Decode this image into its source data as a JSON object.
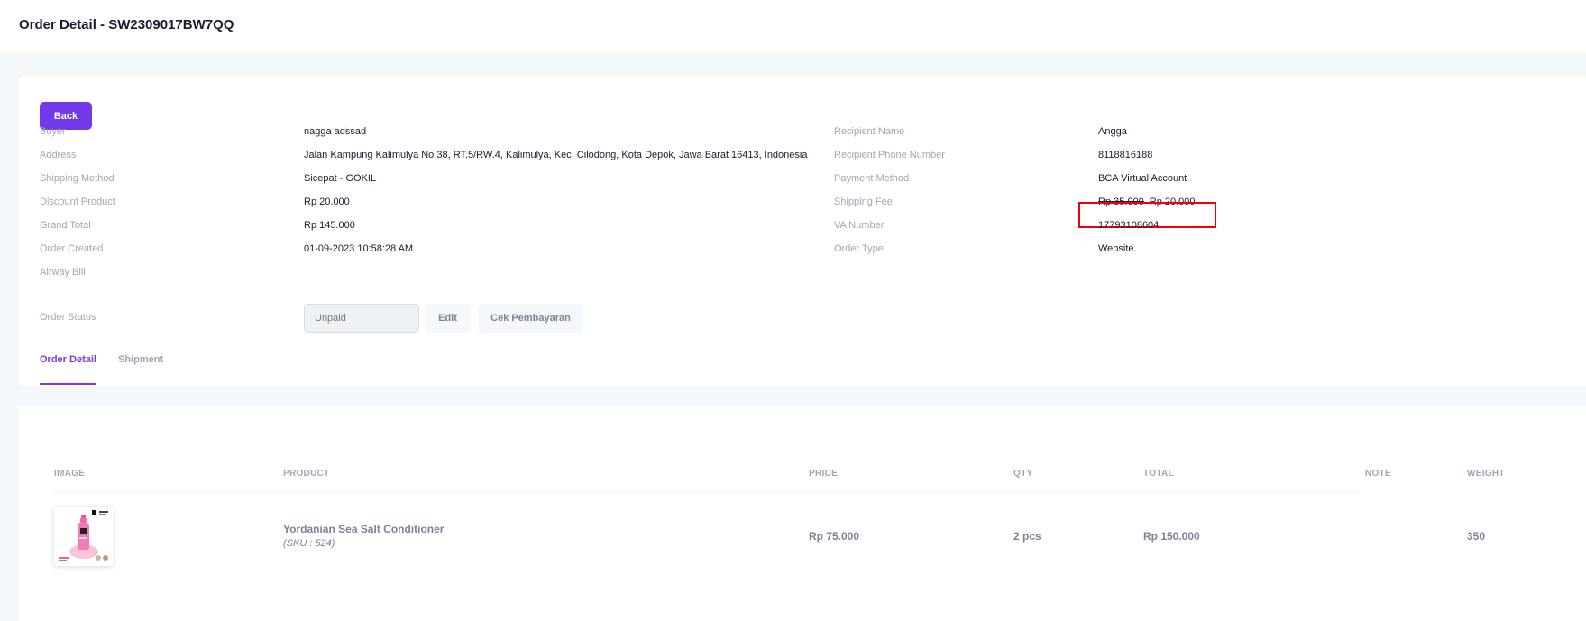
{
  "header": {
    "title": "Order Detail - SW2309017BW7QQ"
  },
  "back_label": "Back",
  "left_fields": [
    {
      "label": "Buyer",
      "value": "nagga adssad"
    },
    {
      "label": "Address",
      "value": "Jalan Kampung Kalimulya No.38, RT.5/RW.4, Kalimulya, Kec. Cilodong, Kota Depok, Jawa Barat 16413, Indonesia"
    },
    {
      "label": "Shipping Method",
      "value": "Sicepat - GOKIL"
    },
    {
      "label": "Discount Product",
      "value": "Rp 20.000"
    },
    {
      "label": "Grand Total",
      "value": "Rp 145.000"
    },
    {
      "label": "Order Created",
      "value": "01-09-2023 10:58:28 AM"
    },
    {
      "label": "Airway Bill",
      "value": ""
    },
    {
      "label": "Order Status",
      "value": ""
    }
  ],
  "right_fields": [
    {
      "label": "Recipient Name",
      "value": "Angga"
    },
    {
      "label": "Recipient Phone Number",
      "value": "8118816188"
    },
    {
      "label": "Payment Method",
      "value": "BCA Virtual Account"
    },
    {
      "label": "Shipping Fee",
      "value": ""
    },
    {
      "label": "VA Number",
      "value": "17793108604"
    },
    {
      "label": "Order Type",
      "value": "Website"
    }
  ],
  "shipping_fee": {
    "original": "Rp 35.000",
    "discounted": "Rp 20.000"
  },
  "order_status": {
    "value": "Unpaid",
    "edit_label": "Edit",
    "check_label": "Cek Pembayaran"
  },
  "tabs": [
    {
      "label": "Order Detail"
    },
    {
      "label": "Shipment"
    }
  ],
  "table": {
    "headers": [
      "IMAGE",
      "PRODUCT",
      "PRICE",
      "QTY",
      "TOTAL",
      "NOTE",
      "WEIGHT"
    ],
    "rows": [
      {
        "product": "Yordanian Sea Salt Conditioner",
        "sku": "(SKU : 524)",
        "price": "Rp 75.000",
        "qty": "2 pcs",
        "total": "Rp 150.000",
        "note": "",
        "weight": "350"
      }
    ]
  },
  "colors": {
    "accent": "#7239ea",
    "highlight_box": "#f1000a",
    "label_gray": "#a1a5b7"
  }
}
